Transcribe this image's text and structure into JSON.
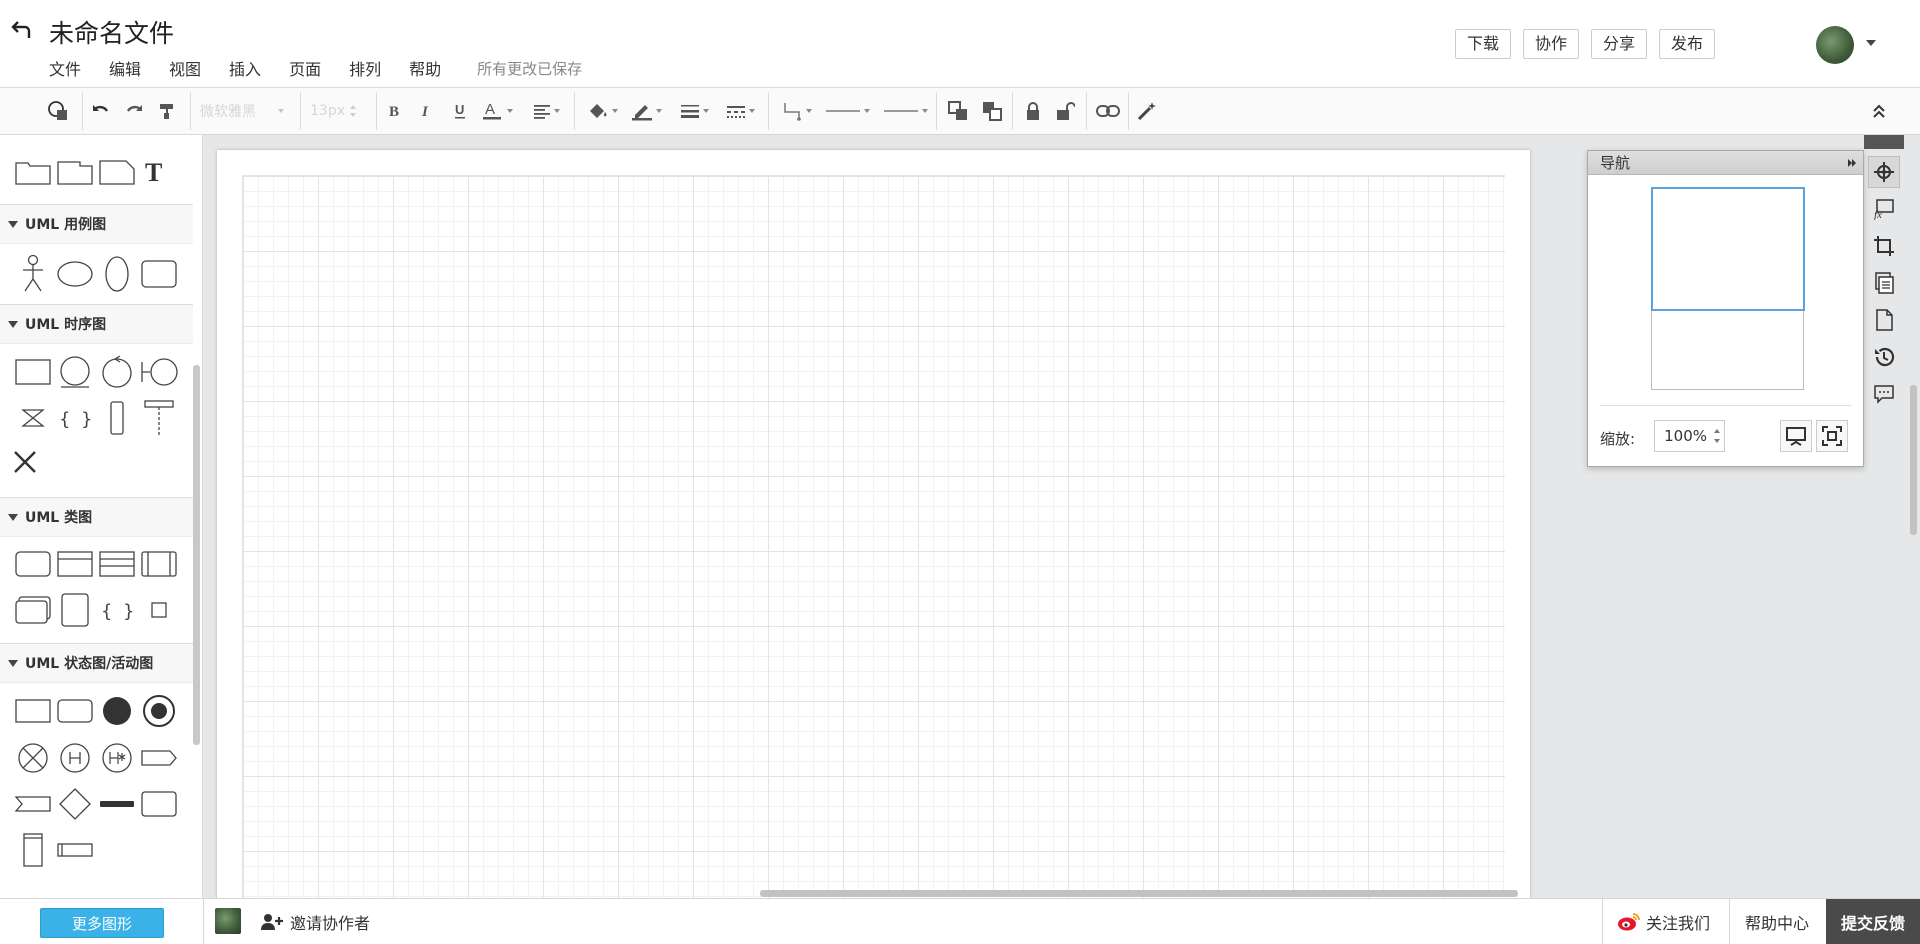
{
  "header": {
    "doc_title": "未命名文件",
    "menu": [
      "文件",
      "编辑",
      "视图",
      "插入",
      "页面",
      "排列",
      "帮助"
    ],
    "save_status": "所有更改已保存",
    "buttons": {
      "download": "下载",
      "collaborate": "协作",
      "share": "分享",
      "publish": "发布"
    }
  },
  "toolbar": {
    "font_family": "微软雅黑",
    "font_size": "13px"
  },
  "sidebar": {
    "sections": {
      "uml_usecase": "UML 用例图",
      "uml_sequence": "UML 时序图",
      "uml_class": "UML 类图",
      "uml_state": "UML 状态图/活动图"
    }
  },
  "nav_panel": {
    "title": "导航",
    "zoom_label": "缩放:",
    "zoom_value": "100%"
  },
  "statusbar": {
    "more_shapes": "更多图形",
    "invite": "邀请协作者",
    "follow": "关注我们",
    "help_center": "帮助中心",
    "feedback": "提交反馈"
  }
}
